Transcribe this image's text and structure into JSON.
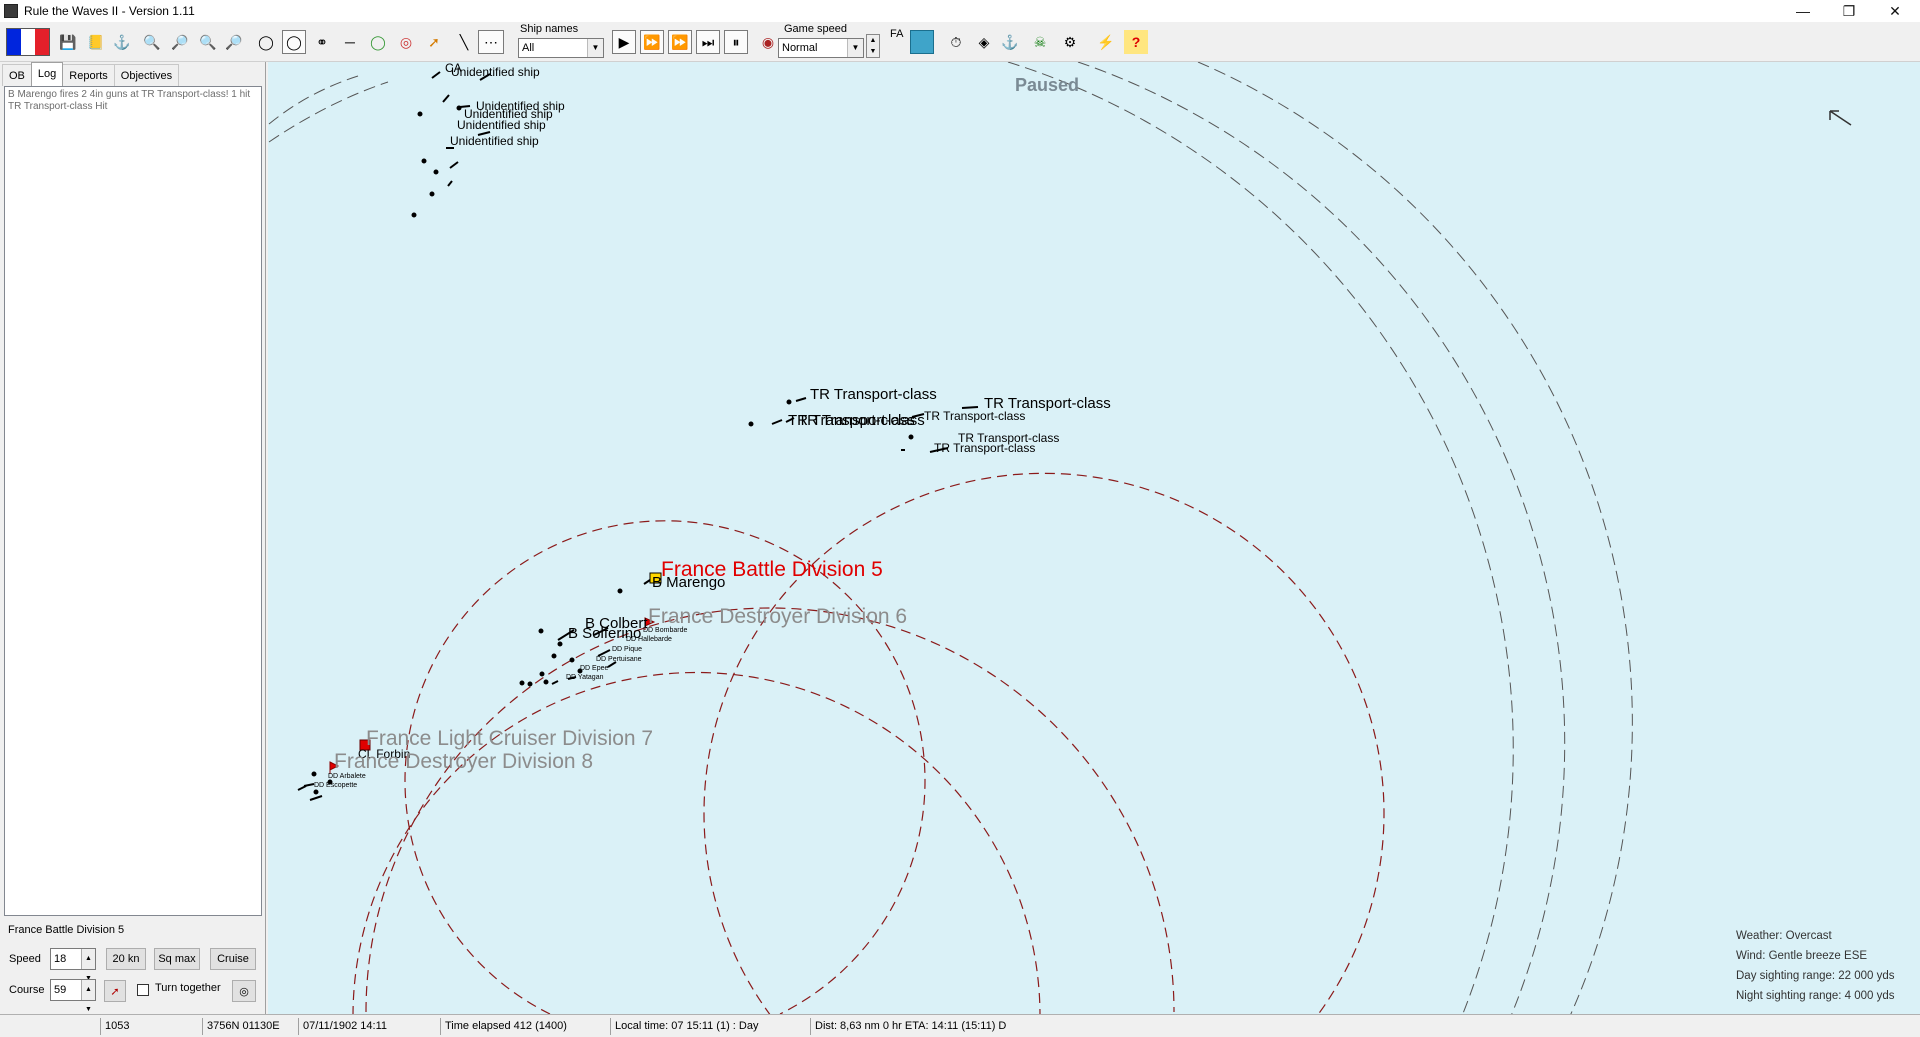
{
  "window": {
    "title": "Rule the Waves II - Version 1.11",
    "controls": {
      "minimize": "—",
      "restore": "❐",
      "close": "✕"
    }
  },
  "toolbar": {
    "ship_names_label": "Ship names",
    "ship_names_value": "All",
    "game_speed_label": "Game speed",
    "game_speed_value": "Normal",
    "fa_label": "FA",
    "flag_colors": [
      "#0025dd",
      "#ffffff",
      "#e4202a"
    ]
  },
  "left_panel": {
    "tabs": [
      "OB",
      "Log",
      "Reports",
      "Objectives"
    ],
    "active_tab": "Log",
    "log_lines": [
      "B Marengo fires 2 4in guns at TR Transport-class! 1 hit",
      "TR Transport-class Hit"
    ],
    "selected_unit": "France Battle Division 5",
    "speed_label": "Speed",
    "speed_value": "18",
    "kn20_button": "20 kn",
    "sqmax_button": "Sq max",
    "cruise_button": "Cruise",
    "course_label": "Course",
    "course_value": "59",
    "turn_together_label": "Turn together"
  },
  "map": {
    "paused_text": "Paused",
    "ship_labels": {
      "ca": "CA",
      "b": "B",
      "unid1": "Unidentified ship",
      "unid2": "Unidentified ship",
      "unid3": "Unidentified ship",
      "unid4": "Unidentified ship",
      "unid5": "Unidentified ship",
      "tr1": "TR Transport-class",
      "tr2": "TR Transport-class",
      "tr3": "TR Transport-class",
      "tr4": "TR Transport-class",
      "tr5": "TR Transport-class",
      "tr6": "TR Transport-class",
      "tr7": "TR Transport-class",
      "marengo": "B Marengo",
      "colbert": "B Colbert",
      "solferino": "B Solferino",
      "bombarde": "DD Bombarde",
      "hallebarde": "DD Hallebarde",
      "pique": "DD Pique",
      "pertuisane": "DD Pertuisane",
      "epee": "DD Epee",
      "yatagan": "DD Yatagan",
      "forbin": "CL Forbin",
      "arbalete": "DD Arbalete",
      "escopette": "DD Escopette"
    },
    "groups": {
      "battle_div5": "France Battle Division 5",
      "destroyer_div6": "France Destroyer Division 6",
      "light_cruiser_div7": "France Light Cruiser Division 7",
      "destroyer_div8": "France Destroyer Division 8"
    },
    "weather": {
      "weather": "Weather: Overcast",
      "wind": "Wind: Gentle breeze  ESE",
      "day_range": "Day sighting range: 22 000 yds",
      "night_range": "Night sighting range: 4 000 yds"
    },
    "colors": {
      "sea": "#daf1f7",
      "selected_group": "#e00000",
      "group_label": "#8c8c8c",
      "friendly_range_ring": "#8b1a1a"
    }
  },
  "status_bar": {
    "turn": "1053",
    "position": "3756N 01130E",
    "date": "07/11/1902 14:11",
    "elapsed": "Time elapsed 412 (1400)",
    "local_time": "Local time: 07 15:11 (1) : Day",
    "distance": "Dist: 8,63 nm 0 hr ETA: 14:11 (15:11) D"
  }
}
